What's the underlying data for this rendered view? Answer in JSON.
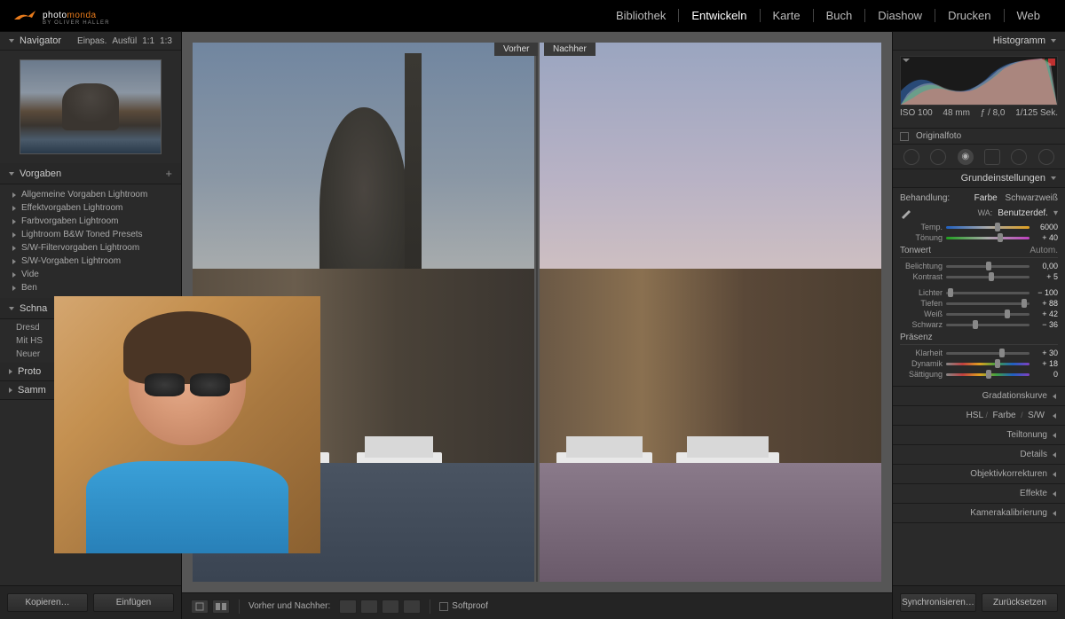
{
  "logo": {
    "p1": "photo",
    "p2": "monda",
    "sub": "BY OLIVER HALLER"
  },
  "modules": [
    "Bibliothek",
    "Entwickeln",
    "Karte",
    "Buch",
    "Diashow",
    "Drucken",
    "Web"
  ],
  "active_module": "Entwickeln",
  "left": {
    "navigator": {
      "label": "Navigator",
      "opts": [
        "Einpas.",
        "Ausfül",
        "1:1",
        "1:3"
      ]
    },
    "presets": {
      "label": "Vorgaben",
      "items": [
        "Allgemeine Vorgaben Lightroom",
        "Effektvorgaben Lightroom",
        "Farbvorgaben Lightroom",
        "Lightroom B&W Toned Presets",
        "S/W-Filtervorgaben Lightroom",
        "S/W-Vorgaben Lightroom",
        "Vide",
        "Ben"
      ]
    },
    "snapshots": {
      "label": "Schna",
      "items": [
        "Dresd",
        "Mit HS",
        "Neuer"
      ]
    },
    "history": {
      "label": "Proto"
    },
    "collections": {
      "label": "Samm"
    },
    "copy": "Kopieren…",
    "paste": "Einfügen"
  },
  "center": {
    "before": "Vorher",
    "after": "Nachher",
    "ba_label": "Vorher und Nachher:",
    "softproof": "Softproof"
  },
  "right": {
    "histogram": {
      "label": "Histogramm",
      "iso": "ISO 100",
      "focal": "48 mm",
      "aperture": "ƒ / 8,0",
      "shutter": "1/125 Sek."
    },
    "original": "Originalfoto",
    "basic": {
      "label": "Grundeinstellungen",
      "treat_label": "Behandlung:",
      "color": "Farbe",
      "bw": "Schwarzweiß",
      "wb_label": "WA:",
      "wb_value": "Benutzerdef.",
      "temp_label": "Temp.",
      "temp_val": "6000",
      "tint_label": "Tönung",
      "tint_val": "+ 40",
      "tone_label": "Tonwert",
      "auto": "Autom.",
      "exposure_label": "Belichtung",
      "exposure_val": "0,00",
      "contrast_label": "Kontrast",
      "contrast_val": "+ 5",
      "highlights_label": "Lichter",
      "highlights_val": "− 100",
      "shadows_label": "Tiefen",
      "shadows_val": "+ 88",
      "whites_label": "Weiß",
      "whites_val": "+ 42",
      "blacks_label": "Schwarz",
      "blacks_val": "− 36",
      "presence_label": "Präsenz",
      "clarity_label": "Klarheit",
      "clarity_val": "+ 30",
      "vibrance_label": "Dynamik",
      "vibrance_val": "+ 18",
      "saturation_label": "Sättigung",
      "saturation_val": "0"
    },
    "panels": {
      "tonecurve": "Gradationskurve",
      "hsl": "HSL",
      "hsl_sub1": "Farbe",
      "hsl_sub2": "S/W",
      "split": "Teiltonung",
      "detail": "Details",
      "lens": "Objektivkorrekturen",
      "effects": "Effekte",
      "cal": "Kamerakalibrierung"
    },
    "sync": "Synchronisieren…",
    "reset": "Zurücksetzen"
  }
}
